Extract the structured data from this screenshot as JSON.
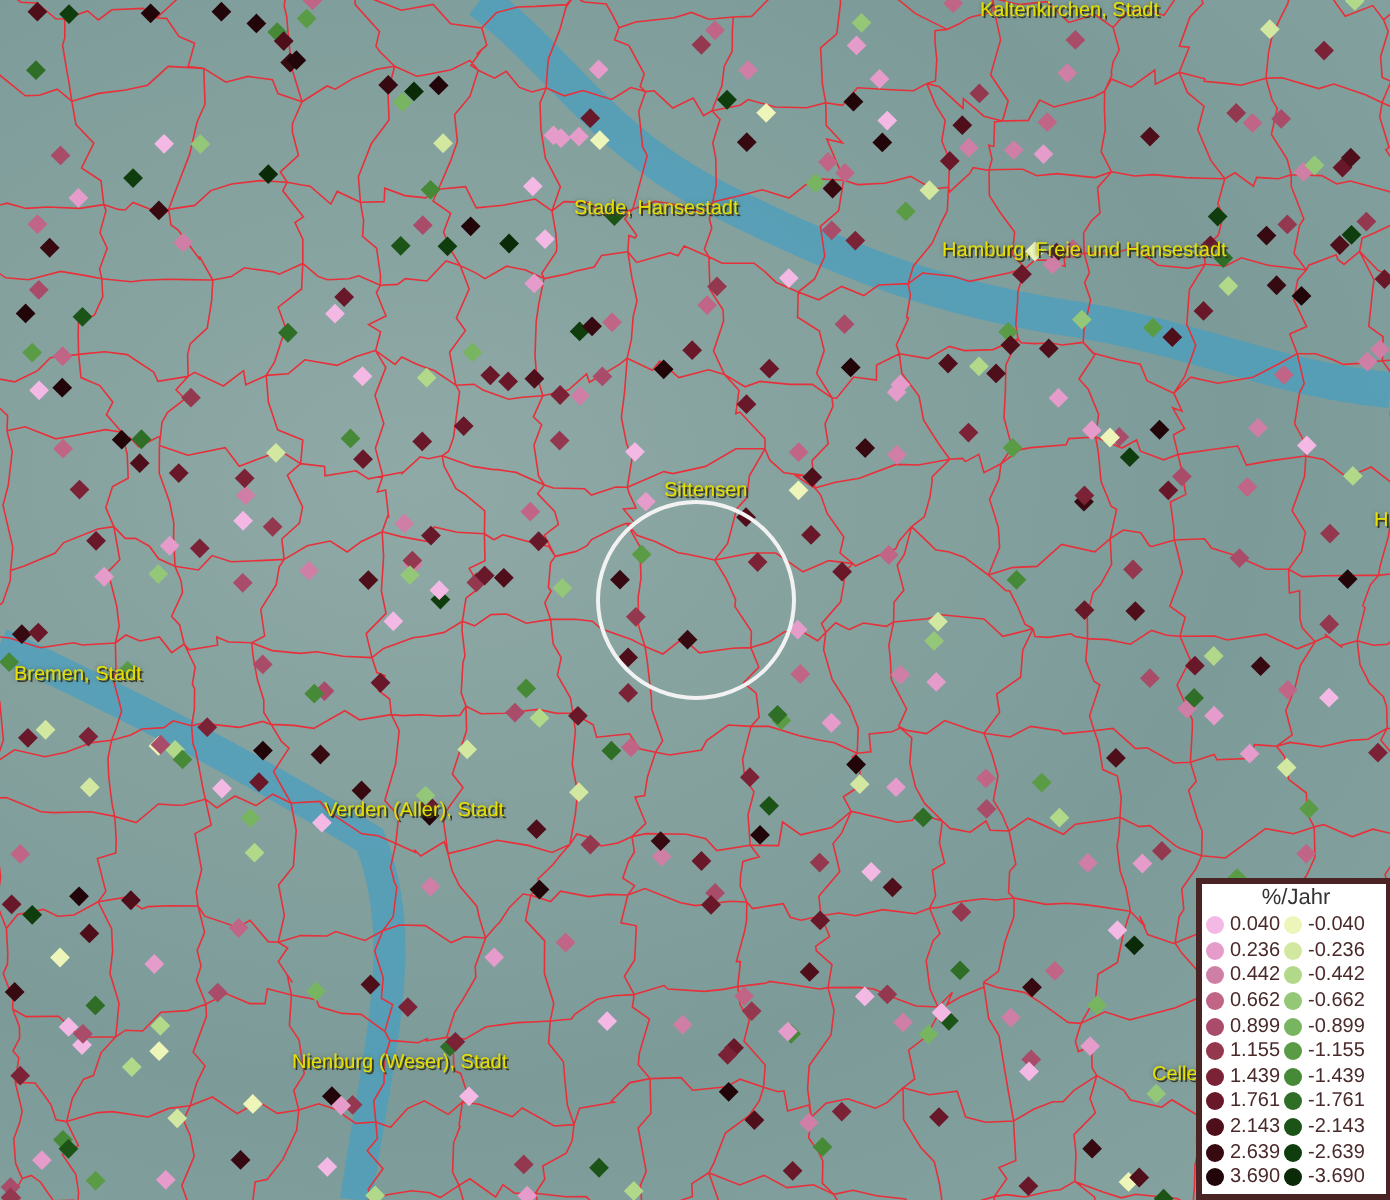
{
  "map": {
    "place_labels": [
      "Kaltenkirchen, Stadt",
      "Stade, Hansestadt",
      "Hamburg, Freie und Hansestadt",
      "Sittensen",
      "Bremen, Stadt",
      "Verden (Aller), Stadt",
      "Nienburg (Weser), Stadt",
      "Celle",
      "H"
    ]
  },
  "legend": {
    "title": "%/Jahr",
    "positive": [
      {
        "value": "0.040",
        "color": "#f4b8e4"
      },
      {
        "value": "0.236",
        "color": "#e59ccb"
      },
      {
        "value": "0.442",
        "color": "#cf7fa6"
      },
      {
        "value": "0.662",
        "color": "#c06585"
      },
      {
        "value": "0.899",
        "color": "#a84c6a"
      },
      {
        "value": "1.155",
        "color": "#93384f"
      },
      {
        "value": "1.439",
        "color": "#7c2237"
      },
      {
        "value": "1.761",
        "color": "#681828"
      },
      {
        "value": "2.143",
        "color": "#4f0f1a"
      },
      {
        "value": "2.639",
        "color": "#360a10"
      },
      {
        "value": "3.690",
        "color": "#210508"
      }
    ],
    "negative": [
      {
        "value": "-0.040",
        "color": "#eef5b8"
      },
      {
        "value": "-0.236",
        "color": "#d2e8a0"
      },
      {
        "value": "-0.442",
        "color": "#b2d88a"
      },
      {
        "value": "-0.662",
        "color": "#94c878"
      },
      {
        "value": "-0.899",
        "color": "#78b560"
      },
      {
        "value": "-1.155",
        "color": "#5a9c45"
      },
      {
        "value": "-1.439",
        "color": "#468a37"
      },
      {
        "value": "-1.761",
        "color": "#2f6e26"
      },
      {
        "value": "-2.143",
        "color": "#1c5418"
      },
      {
        "value": "-2.639",
        "color": "#103d0e"
      },
      {
        "value": "-3.690",
        "color": "#0a2a08"
      }
    ]
  }
}
